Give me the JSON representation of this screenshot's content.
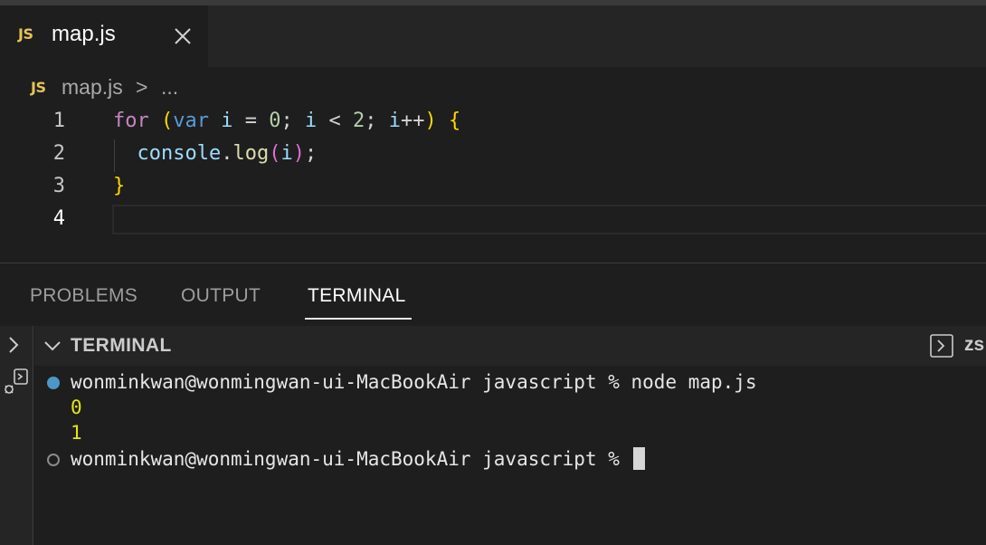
{
  "tab": {
    "badge": "JS",
    "title": "map.js",
    "close_icon": "close-icon"
  },
  "breadcrumb": {
    "badge": "JS",
    "file": "map.js",
    "separator": ">",
    "more": "..."
  },
  "editor": {
    "lines": [
      {
        "number": "1"
      },
      {
        "number": "2"
      },
      {
        "number": "3"
      },
      {
        "number": "4"
      }
    ],
    "tokens": {
      "for": "for",
      "open_paren": "(",
      "var": "var",
      "i": "i",
      "eq": " = ",
      "zero": "0",
      "semi1": "; ",
      "lt": " < ",
      "two": "2",
      "semi2": "; ",
      "inc_var": "i",
      "inc": "++",
      "close_paren": ")",
      "open_brace": "{",
      "console": "console",
      "dot": ".",
      "log": "log",
      "call_open": "(",
      "arg": "i",
      "call_close": ")",
      "end_semi": ";",
      "close_brace": "}"
    }
  },
  "panel": {
    "tabs": [
      {
        "label": "PROBLEMS"
      },
      {
        "label": "OUTPUT"
      },
      {
        "label": "TERMINAL"
      }
    ],
    "active_tab": "TERMINAL"
  },
  "terminal": {
    "header_title": "TERMINAL",
    "shell_name": "zs",
    "lines": [
      {
        "text": "wonminkwan@wonmingwan-ui-MacBookAir javascript % node map.js",
        "kind": "command"
      },
      {
        "text": "0",
        "kind": "output"
      },
      {
        "text": "1",
        "kind": "output"
      },
      {
        "text": "wonminkwan@wonmingwan-ui-MacBookAir javascript % ",
        "kind": "prompt"
      }
    ]
  },
  "colors": {
    "keyword": "#c586c0",
    "storage": "#569cd6",
    "variable": "#9cdcfe",
    "number": "#b5cea8",
    "function": "#dcdcaa",
    "bracket_level1": "#ffd700",
    "bracket_level2": "#da70d6",
    "output": "#e5e510",
    "js_badge": "#e5c454",
    "status_dot": "#4c97c6"
  }
}
